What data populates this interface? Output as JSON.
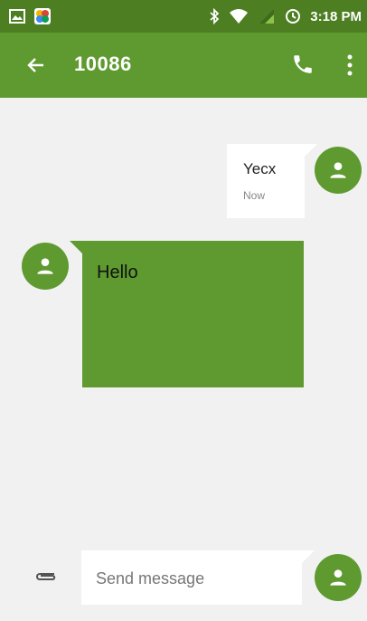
{
  "status_bar": {
    "time": "3:18 PM",
    "icons": [
      "image-notification-icon",
      "gallery-app-icon",
      "bluetooth-icon",
      "wifi-icon",
      "signal-icon",
      "alarm-icon"
    ]
  },
  "app_bar": {
    "title": "10086",
    "icons": [
      "back-arrow-icon",
      "phone-icon",
      "more-vert-icon"
    ]
  },
  "messages": [
    {
      "direction": "outgoing",
      "text": "Yecx",
      "time": "Now"
    },
    {
      "direction": "incoming",
      "text": "Hello"
    }
  ],
  "compose": {
    "placeholder": "Send message",
    "value": ""
  },
  "colors": {
    "status_bar": "#4d7f22",
    "accent": "#5f9a30",
    "background": "#f1f1f1"
  }
}
